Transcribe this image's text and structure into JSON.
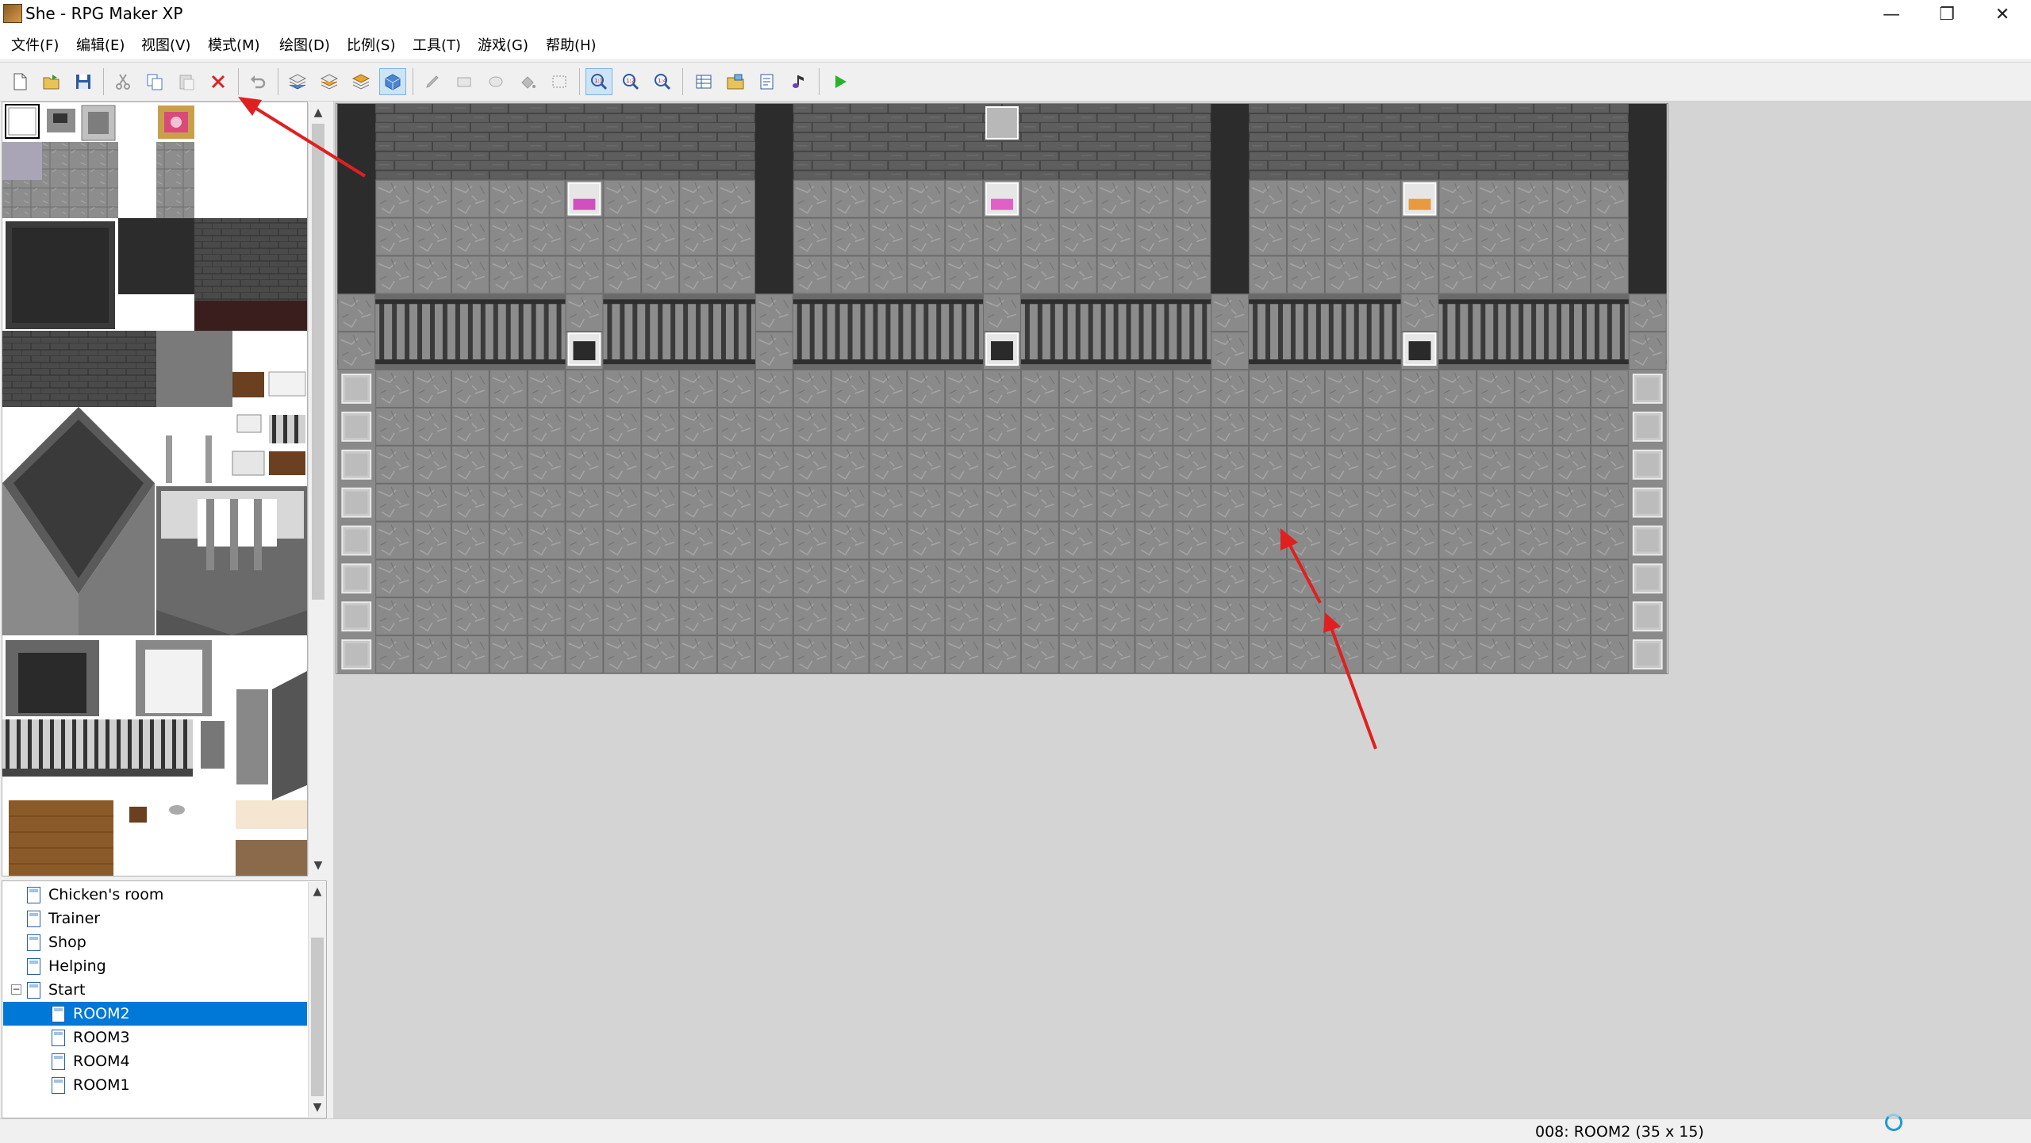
{
  "window": {
    "title": "She - RPG Maker XP",
    "controls": {
      "minimize": "—",
      "restore": "❐",
      "close": "✕"
    }
  },
  "menu": [
    "文件(F)",
    "编辑(E)",
    "视图(V)",
    "模式(M)",
    "绘图(D)",
    "比例(S)",
    "工具(T)",
    "游戏(G)",
    "帮助(H)"
  ],
  "toolbar": {
    "items": [
      "new-icon",
      "open-icon",
      "save-icon",
      "cut-icon",
      "copy-icon",
      "paste-icon",
      "delete-icon",
      "undo-icon",
      "layer1-icon",
      "layer2-icon",
      "layer3-icon",
      "events-layer-icon",
      "pencil-icon",
      "rectangle-icon",
      "ellipse-icon",
      "fill-icon",
      "select-icon",
      "zoom-1-1-icon",
      "zoom-1-2-icon",
      "zoom-1-4-icon",
      "database-icon",
      "materials-icon",
      "script-editor-icon",
      "sound-test-icon",
      "playtest-icon"
    ],
    "active": [
      "events-layer-icon",
      "zoom-1-1-icon"
    ]
  },
  "map_tree": {
    "items": [
      {
        "label": "Chicken's room",
        "level": 0
      },
      {
        "label": "Trainer",
        "level": 0
      },
      {
        "label": "Shop",
        "level": 0
      },
      {
        "label": "Helping",
        "level": 0
      },
      {
        "label": "Start",
        "level": 0,
        "expanded": true
      },
      {
        "label": "ROOM2",
        "level": 1,
        "selected": true
      },
      {
        "label": "ROOM3",
        "level": 1
      },
      {
        "label": "ROOM4",
        "level": 1
      },
      {
        "label": "ROOM1",
        "level": 1
      }
    ]
  },
  "map": {
    "width_tiles": 35,
    "height_tiles": 15,
    "colors": {
      "floor": "#8a8a8a",
      "wall": "#5e5e5e",
      "pillar": "#2c2c2c",
      "rail": "#3a3a3a"
    }
  },
  "status": {
    "text": "008: ROOM2 (35 x 15)"
  },
  "colors": {
    "selection": "#0078d7",
    "annotation_arrow": "#e02020"
  }
}
